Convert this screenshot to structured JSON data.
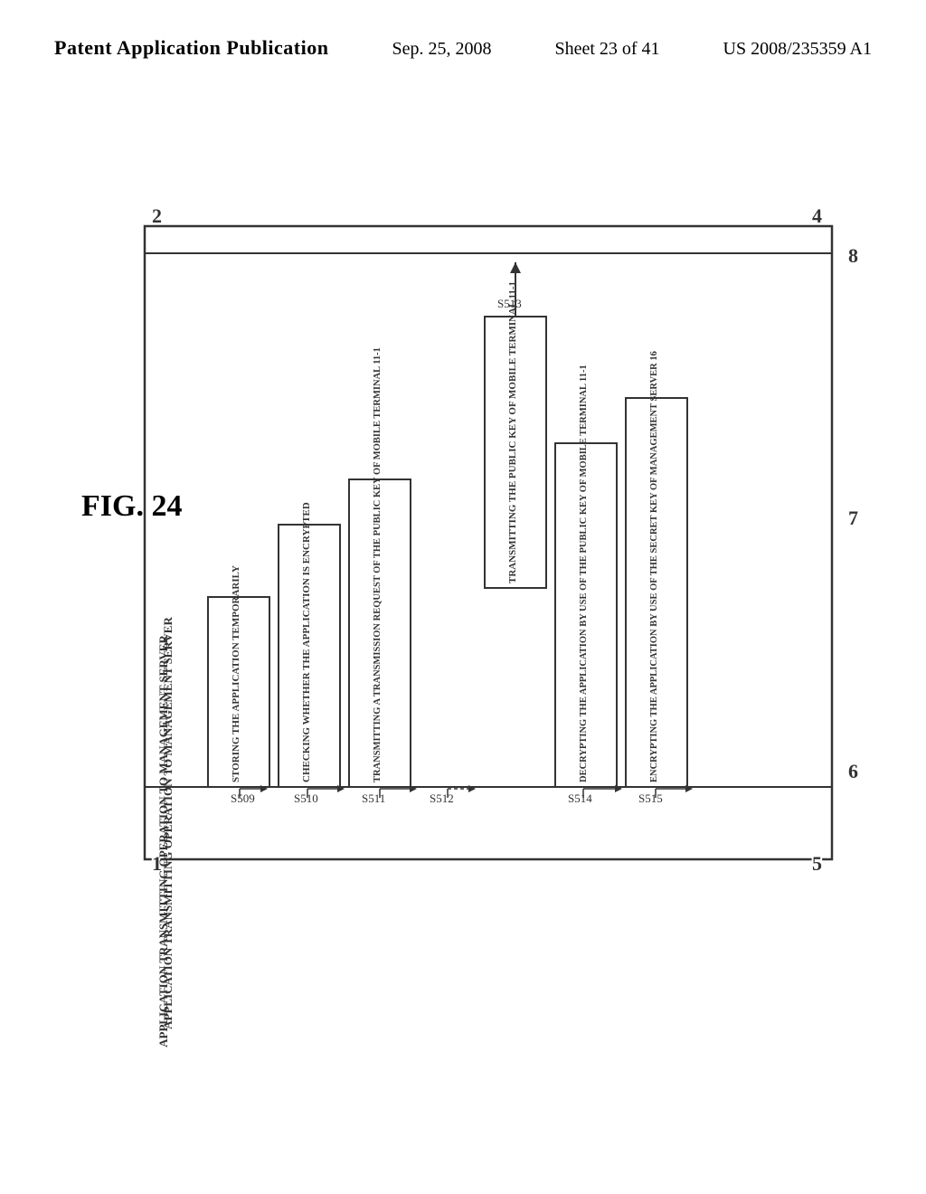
{
  "header": {
    "left": "Patent Application Publication",
    "center": "Sep. 25, 2008",
    "sheet": "Sheet 23 of 41",
    "right": "US 2008/235359 A1"
  },
  "figure": {
    "label": "FIG. 24",
    "outer_corners": {
      "tl": "2",
      "tr": "4",
      "bl": "1",
      "br": "5"
    },
    "side_label_left": "APPLICATION TRANSMITTING OPERATION TO MANAGEMENT SERVER",
    "right_labels": {
      "top": "8",
      "mid": "7",
      "bot": "6"
    },
    "steps": [
      {
        "id": "S509",
        "text": "STORING THE APPLICATION TEMPORARILY"
      },
      {
        "id": "S510",
        "text": "CHECKING WHETHER THE APPLICATION IS ENCRYPTED"
      },
      {
        "id": "S511",
        "text": "TRANSMITTING A TRANSMISSION REQUEST OF THE PUBLIC KEY OF MOBILE TERMINAL 11-1"
      },
      {
        "id": "S512",
        "text": ""
      },
      {
        "id": "S513",
        "text": "TRANSMITTING THE PUBLIC KEY OF MOBILE TERMINAL 11-1"
      },
      {
        "id": "S514",
        "text": "DECRYPTING THE APPLICATION BY USE OF THE PUBLIC KEY OF MOBILE TERMINAL 11-1"
      },
      {
        "id": "S515",
        "text": "ENCRYPTING THE APPLICATION BY USE OF THE SECRET KEY OF MANAGEMENT SERVER 16"
      }
    ]
  }
}
